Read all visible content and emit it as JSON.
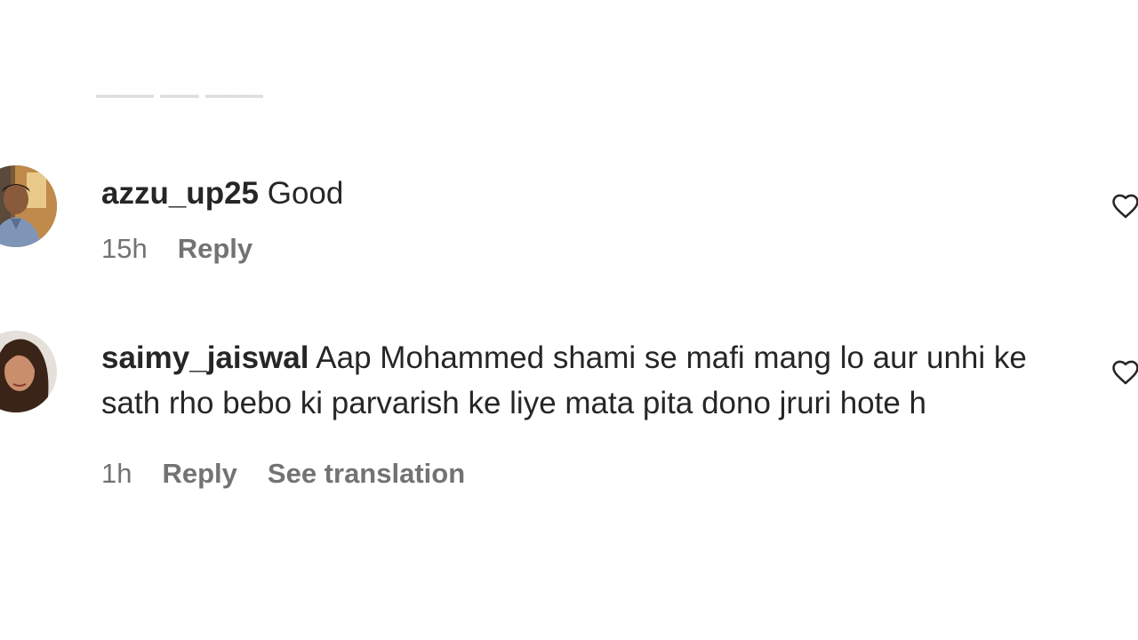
{
  "comments": [
    {
      "username": "azzu_up25",
      "text": "Good",
      "time": "15h",
      "reply_label": "Reply"
    },
    {
      "username": "saimy_jaiswal",
      "text": "Aap Mohammed shami se mafi mang lo aur unhi ke sath rho bebo ki parvarish ke liye mata pita dono jruri hote h",
      "time": "1h",
      "reply_label": "Reply",
      "translate_label": "See translation"
    }
  ],
  "icons": {
    "like": "heart-outline-icon"
  }
}
